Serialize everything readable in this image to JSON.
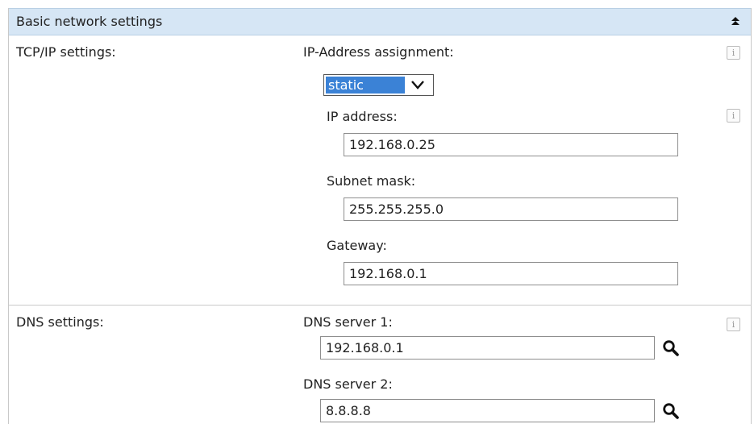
{
  "header": {
    "title": "Basic network settings",
    "collapse_icon": "collapse-up-icon"
  },
  "tcpip": {
    "section_label": "TCP/IP settings:",
    "assignment_label": "IP-Address assignment:",
    "assignment_value": "static",
    "ip_label": "IP address:",
    "ip_value": "192.168.0.25",
    "subnet_label": "Subnet mask:",
    "subnet_value": "255.255.255.0",
    "gateway_label": "Gateway:",
    "gateway_value": "192.168.0.1",
    "info_icon": "i"
  },
  "dns": {
    "section_label": "DNS settings:",
    "server1_label": "DNS server 1:",
    "server1_value": "192.168.0.1",
    "server2_label": "DNS server 2:",
    "server2_value": "8.8.8.8",
    "info_icon": "i",
    "lookup_icon": "search-icon"
  },
  "colors": {
    "header_bg": "#d6e6f5",
    "select_highlight": "#3b82d6",
    "border": "#c9c9c9"
  }
}
